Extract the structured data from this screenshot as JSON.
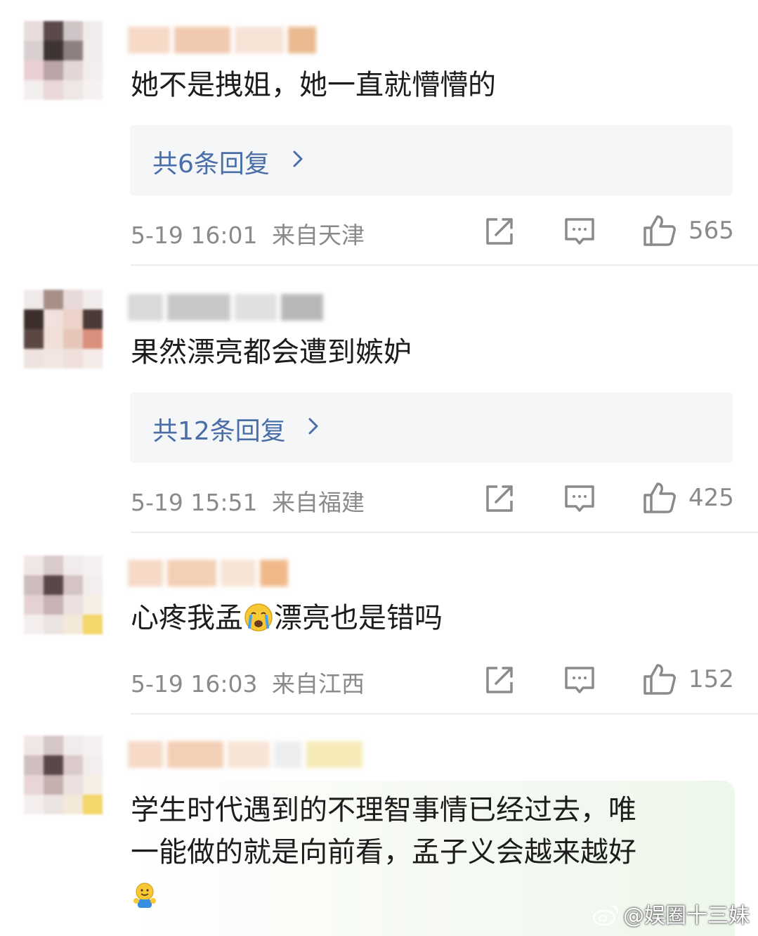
{
  "comments": [
    {
      "text": "她不是拽姐，她一直就懵懵的",
      "replies_label": "共6条回复",
      "date": "5-19 16:01",
      "location": "来自天津",
      "likes": "565"
    },
    {
      "text": "果然漂亮都会遭到嫉妒",
      "replies_label": "共12条回复",
      "date": "5-19 15:51",
      "location": "来自福建",
      "likes": "425"
    },
    {
      "text_before": "心疼我孟",
      "text_after": "漂亮也是错吗",
      "emoji": "crying-face-icon",
      "date": "5-19 16:03",
      "location": "来自江西",
      "likes": "152"
    },
    {
      "line1": "学生时代遇到的不理智事情已经过去，唯",
      "line2": "一能做的就是向前看，孟子义会越来越好",
      "emoji": "hugging-face-icon"
    }
  ],
  "watermark": "@娱圈十三妹",
  "colors": {
    "reply_link": "#4a6ea8",
    "meta_text": "#8a8a8a",
    "reply_box_bg": "#f5f6f8",
    "highlight_bg": "#eef7ec"
  }
}
